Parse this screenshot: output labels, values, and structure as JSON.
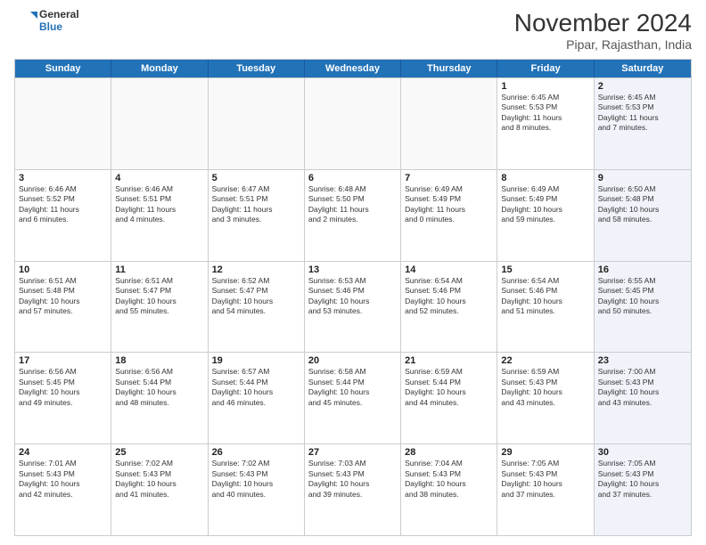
{
  "header": {
    "logo_line1": "General",
    "logo_line2": "Blue",
    "title": "November 2024",
    "subtitle": "Pipar, Rajasthan, India"
  },
  "calendar": {
    "days_of_week": [
      "Sunday",
      "Monday",
      "Tuesday",
      "Wednesday",
      "Thursday",
      "Friday",
      "Saturday"
    ],
    "weeks": [
      [
        {
          "day": "",
          "info": ""
        },
        {
          "day": "",
          "info": ""
        },
        {
          "day": "",
          "info": ""
        },
        {
          "day": "",
          "info": ""
        },
        {
          "day": "",
          "info": ""
        },
        {
          "day": "1",
          "info": "Sunrise: 6:45 AM\nSunset: 5:53 PM\nDaylight: 11 hours\nand 8 minutes."
        },
        {
          "day": "2",
          "info": "Sunrise: 6:45 AM\nSunset: 5:53 PM\nDaylight: 11 hours\nand 7 minutes."
        }
      ],
      [
        {
          "day": "3",
          "info": "Sunrise: 6:46 AM\nSunset: 5:52 PM\nDaylight: 11 hours\nand 6 minutes."
        },
        {
          "day": "4",
          "info": "Sunrise: 6:46 AM\nSunset: 5:51 PM\nDaylight: 11 hours\nand 4 minutes."
        },
        {
          "day": "5",
          "info": "Sunrise: 6:47 AM\nSunset: 5:51 PM\nDaylight: 11 hours\nand 3 minutes."
        },
        {
          "day": "6",
          "info": "Sunrise: 6:48 AM\nSunset: 5:50 PM\nDaylight: 11 hours\nand 2 minutes."
        },
        {
          "day": "7",
          "info": "Sunrise: 6:49 AM\nSunset: 5:49 PM\nDaylight: 11 hours\nand 0 minutes."
        },
        {
          "day": "8",
          "info": "Sunrise: 6:49 AM\nSunset: 5:49 PM\nDaylight: 10 hours\nand 59 minutes."
        },
        {
          "day": "9",
          "info": "Sunrise: 6:50 AM\nSunset: 5:48 PM\nDaylight: 10 hours\nand 58 minutes."
        }
      ],
      [
        {
          "day": "10",
          "info": "Sunrise: 6:51 AM\nSunset: 5:48 PM\nDaylight: 10 hours\nand 57 minutes."
        },
        {
          "day": "11",
          "info": "Sunrise: 6:51 AM\nSunset: 5:47 PM\nDaylight: 10 hours\nand 55 minutes."
        },
        {
          "day": "12",
          "info": "Sunrise: 6:52 AM\nSunset: 5:47 PM\nDaylight: 10 hours\nand 54 minutes."
        },
        {
          "day": "13",
          "info": "Sunrise: 6:53 AM\nSunset: 5:46 PM\nDaylight: 10 hours\nand 53 minutes."
        },
        {
          "day": "14",
          "info": "Sunrise: 6:54 AM\nSunset: 5:46 PM\nDaylight: 10 hours\nand 52 minutes."
        },
        {
          "day": "15",
          "info": "Sunrise: 6:54 AM\nSunset: 5:46 PM\nDaylight: 10 hours\nand 51 minutes."
        },
        {
          "day": "16",
          "info": "Sunrise: 6:55 AM\nSunset: 5:45 PM\nDaylight: 10 hours\nand 50 minutes."
        }
      ],
      [
        {
          "day": "17",
          "info": "Sunrise: 6:56 AM\nSunset: 5:45 PM\nDaylight: 10 hours\nand 49 minutes."
        },
        {
          "day": "18",
          "info": "Sunrise: 6:56 AM\nSunset: 5:44 PM\nDaylight: 10 hours\nand 48 minutes."
        },
        {
          "day": "19",
          "info": "Sunrise: 6:57 AM\nSunset: 5:44 PM\nDaylight: 10 hours\nand 46 minutes."
        },
        {
          "day": "20",
          "info": "Sunrise: 6:58 AM\nSunset: 5:44 PM\nDaylight: 10 hours\nand 45 minutes."
        },
        {
          "day": "21",
          "info": "Sunrise: 6:59 AM\nSunset: 5:44 PM\nDaylight: 10 hours\nand 44 minutes."
        },
        {
          "day": "22",
          "info": "Sunrise: 6:59 AM\nSunset: 5:43 PM\nDaylight: 10 hours\nand 43 minutes."
        },
        {
          "day": "23",
          "info": "Sunrise: 7:00 AM\nSunset: 5:43 PM\nDaylight: 10 hours\nand 43 minutes."
        }
      ],
      [
        {
          "day": "24",
          "info": "Sunrise: 7:01 AM\nSunset: 5:43 PM\nDaylight: 10 hours\nand 42 minutes."
        },
        {
          "day": "25",
          "info": "Sunrise: 7:02 AM\nSunset: 5:43 PM\nDaylight: 10 hours\nand 41 minutes."
        },
        {
          "day": "26",
          "info": "Sunrise: 7:02 AM\nSunset: 5:43 PM\nDaylight: 10 hours\nand 40 minutes."
        },
        {
          "day": "27",
          "info": "Sunrise: 7:03 AM\nSunset: 5:43 PM\nDaylight: 10 hours\nand 39 minutes."
        },
        {
          "day": "28",
          "info": "Sunrise: 7:04 AM\nSunset: 5:43 PM\nDaylight: 10 hours\nand 38 minutes."
        },
        {
          "day": "29",
          "info": "Sunrise: 7:05 AM\nSunset: 5:43 PM\nDaylight: 10 hours\nand 37 minutes."
        },
        {
          "day": "30",
          "info": "Sunrise: 7:05 AM\nSunset: 5:43 PM\nDaylight: 10 hours\nand 37 minutes."
        }
      ]
    ]
  }
}
